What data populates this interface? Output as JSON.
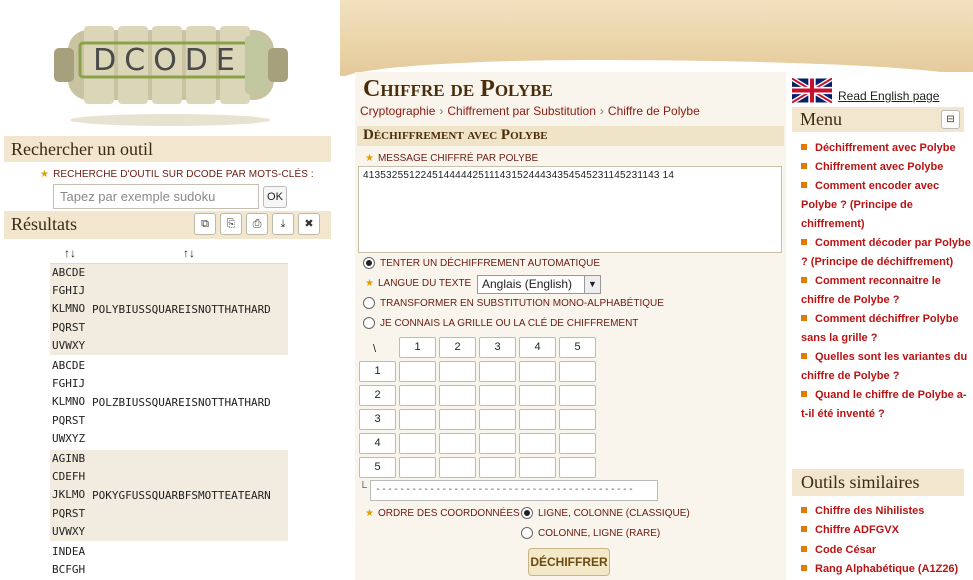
{
  "left": {
    "logo_text": "DCODE",
    "search": {
      "title": "Rechercher un outil",
      "kw_label": "Recherche d'outil sur dCode par mots-clés :",
      "placeholder": "Tapez par exemple sudoku",
      "ok_label": "OK"
    },
    "results": {
      "title": "Résultats",
      "col1": "↑↓",
      "col2": "↑↓",
      "rows": [
        {
          "grid": [
            "ABCDE",
            "FGHIJ",
            "KLMNO",
            "PQRST",
            "UVWXY"
          ],
          "text": "POLYBIUSSQUAREISNOTTHATHARD"
        },
        {
          "grid": [
            "ABCDE",
            "FGHIJ",
            "KLMNO",
            "PQRST",
            "UWXYZ"
          ],
          "text": "POLZBIUSSQUAREISNOTTHATHARD"
        },
        {
          "grid": [
            "AGINB",
            "CDEFH",
            "JKLMO",
            "PQRST",
            "UVWXY"
          ],
          "text": "POKYGFUSSQUARBFSMOTTEATEARN"
        },
        {
          "grid": [
            "INDEA",
            "BCFGH"
          ],
          "text": ""
        }
      ]
    }
  },
  "main": {
    "title": "Chiffre de Polybe",
    "breadcrumb": [
      "Cryptographie",
      "Chiffrement par Substitution",
      "Chiffre de Polybe"
    ],
    "section": "Déchiffrement avec Polybe",
    "msg_label": "Message chiffré par Polybe",
    "msg_value": "4135325512245144444251114315244434354545231145231143 14",
    "opt_auto": "Tenter un déchiffrement automatique",
    "lang_label": "Langue du texte",
    "lang_value": "Anglais (English)",
    "opt_mono": "Transformer en substitution mono-alphabétique",
    "opt_grid": "Je connais la grille ou la clé de chiffrement",
    "grid_corner": "\\",
    "grid_cols": [
      "1",
      "2",
      "3",
      "4",
      "5"
    ],
    "grid_rows": [
      "1",
      "2",
      "3",
      "4",
      "5"
    ],
    "coord_corner": "└",
    "coord_value": "-------------------------------------------",
    "order_label": "Ordre des coordonnées",
    "opt_line": "Ligne, Colonne (classique)",
    "opt_col": "Colonne, Ligne (rare)",
    "decode_label": "DÉCHIFFRER"
  },
  "right": {
    "english_link": "Read English page",
    "menu_title": "Menu",
    "menu_toggle": "⊟",
    "menu_items": [
      "Déchiffrement avec Polybe",
      "Chiffrement avec Polybe",
      "Comment encoder avec Polybe ? (Principe de chiffrement)",
      "Comment décoder par Polybe ? (Principe de déchiffrement)",
      "Comment reconnaitre le chiffre de Polybe ?",
      "Comment déchiffrer Polybe sans la grille ?",
      "Quelles sont les variantes du chiffre de Polybe ?",
      "Quand le chiffre de Polybe a-t-il été inventé ?"
    ],
    "similar_title": "Outils similaires",
    "similar_items": [
      "Chiffre des Nihilistes",
      "Chiffre ADFGVX",
      "Code César",
      "Rang Alphabétique (A1Z26)"
    ]
  },
  "colors": {
    "accent_red": "#b81414",
    "label_red": "#6b1a10",
    "parchment": "#f2e6cf",
    "bullet": "#e07a00"
  }
}
